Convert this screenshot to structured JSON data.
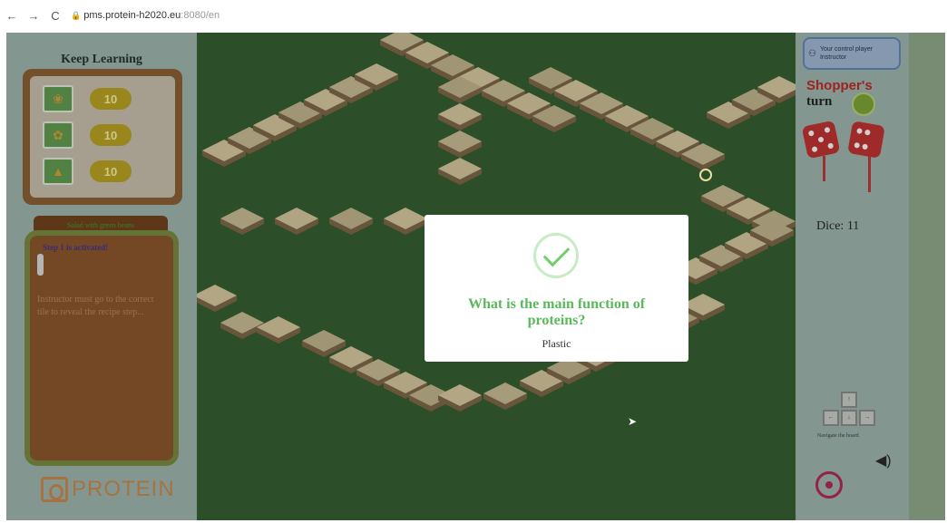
{
  "browser": {
    "back_icon": "arrow-left-icon",
    "forward_icon": "arrow-right-icon",
    "reload_icon": "reload-icon",
    "url_host": "pms.protein-h2020.eu",
    "url_path": ":8080/en"
  },
  "left_panel": {
    "title": "Keep Learning",
    "cards": [
      {
        "value": "10"
      },
      {
        "value": "10"
      },
      {
        "value": "10"
      }
    ],
    "recipe_tab": "Salad with green beans",
    "step_text": "Step 1 is activated!",
    "instruction": "Instructor must go to the correct tile to reveal the recipe step...",
    "logo_text": "PROTEIN"
  },
  "right_panel": {
    "control_text_1": "Your control player",
    "control_text_2": "Instructor",
    "turn_name": "Shopper's",
    "turn_word": "turn",
    "dice_label": "Dice: 11",
    "nav_label": "Navigate the board",
    "speaker_icon": "speaker-icon",
    "broadcast_icon": "broadcast-icon"
  },
  "modal": {
    "question": "What is the main function of proteins?",
    "answer": "Plastic",
    "icon": "checkmark-icon"
  },
  "colors": {
    "board_green": "#2e5a2a",
    "modal_green": "#5cb85c",
    "dice_red": "#c12b2b",
    "turn_red": "#c0201f"
  }
}
